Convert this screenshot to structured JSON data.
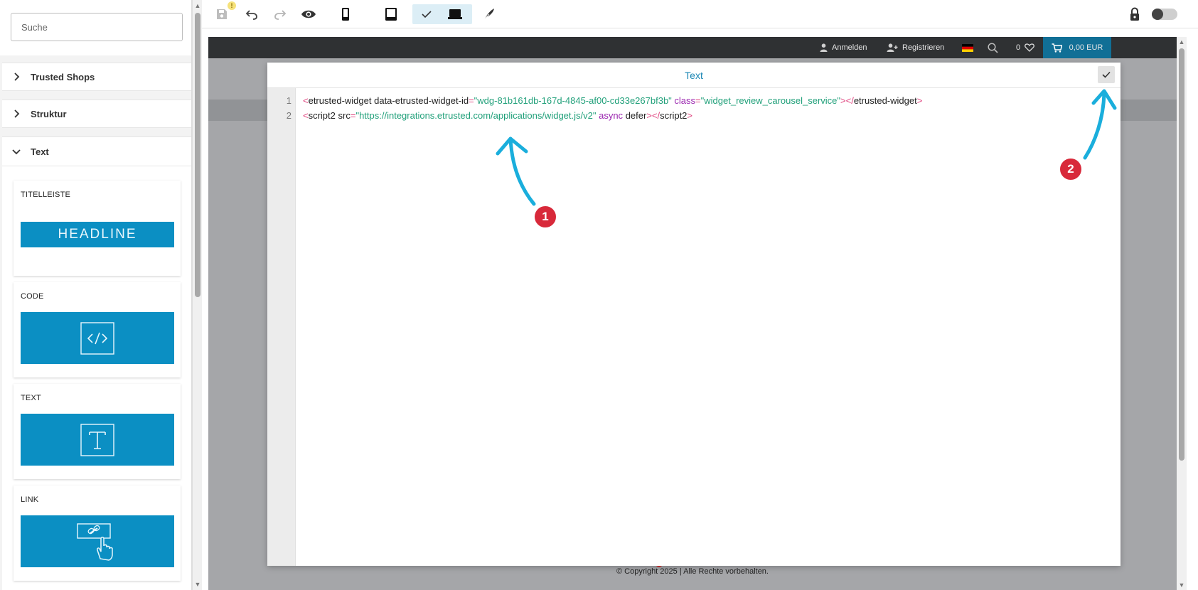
{
  "sidebar": {
    "search_placeholder": "Suche",
    "sections": [
      {
        "label": "Trusted Shops",
        "expanded": false
      },
      {
        "label": "Struktur",
        "expanded": false
      },
      {
        "label": "Text",
        "expanded": true
      }
    ],
    "widgets": [
      {
        "label": "TITELLEISTE",
        "thumb_text": "HEADLINE",
        "icon": "headline-icon"
      },
      {
        "label": "CODE",
        "icon": "code-icon"
      },
      {
        "label": "TEXT",
        "icon": "text-t-icon"
      },
      {
        "label": "LINK",
        "icon": "link-hand-icon"
      }
    ]
  },
  "toolbar": {
    "save_warning": "!",
    "active_view": "desktop",
    "icons": [
      "save-icon",
      "undo-icon",
      "redo-icon",
      "eye-icon",
      "mobile-icon",
      "tablet-icon",
      "check-icon",
      "laptop-icon",
      "pen-icon",
      "lock-icon",
      "toggle"
    ]
  },
  "shop": {
    "nav": {
      "login": "Anmelden",
      "register": "Registrieren",
      "wishlist_count": "0",
      "cart_total": "0,00 EUR"
    },
    "footer": "© Copyright 2025 | Alle Rechte vorbehalten."
  },
  "modal": {
    "title": "Text",
    "code_lines": [
      {
        "number": "1"
      },
      {
        "number": "2"
      }
    ],
    "line1": {
      "tag": "etrusted-widget",
      "attr1": "data-etrusted-widget-id",
      "val1": "\"wdg-81b161db-167d-4845-af00-cd33e267bf3b\"",
      "attr2": "class",
      "val2": "\"widget_review_carousel_service\"",
      "close_tag": "etrusted-widget"
    },
    "line2": {
      "tag": "script2",
      "attr1": "src",
      "val1": "\"https://integrations.etrusted.com/applications/widget.js/v2\"",
      "attr2": "async",
      "attr3": "defer",
      "close_tag": "script2"
    }
  },
  "annotations": {
    "badge1": "1",
    "badge2": "2",
    "arrow_color": "#1aaedc",
    "badge_color": "#d8293a"
  },
  "colors": {
    "accent": "#0b8fc3",
    "nav_bg": "#2f3133",
    "cart_bg": "#116f96",
    "title": "#1a86b4"
  }
}
